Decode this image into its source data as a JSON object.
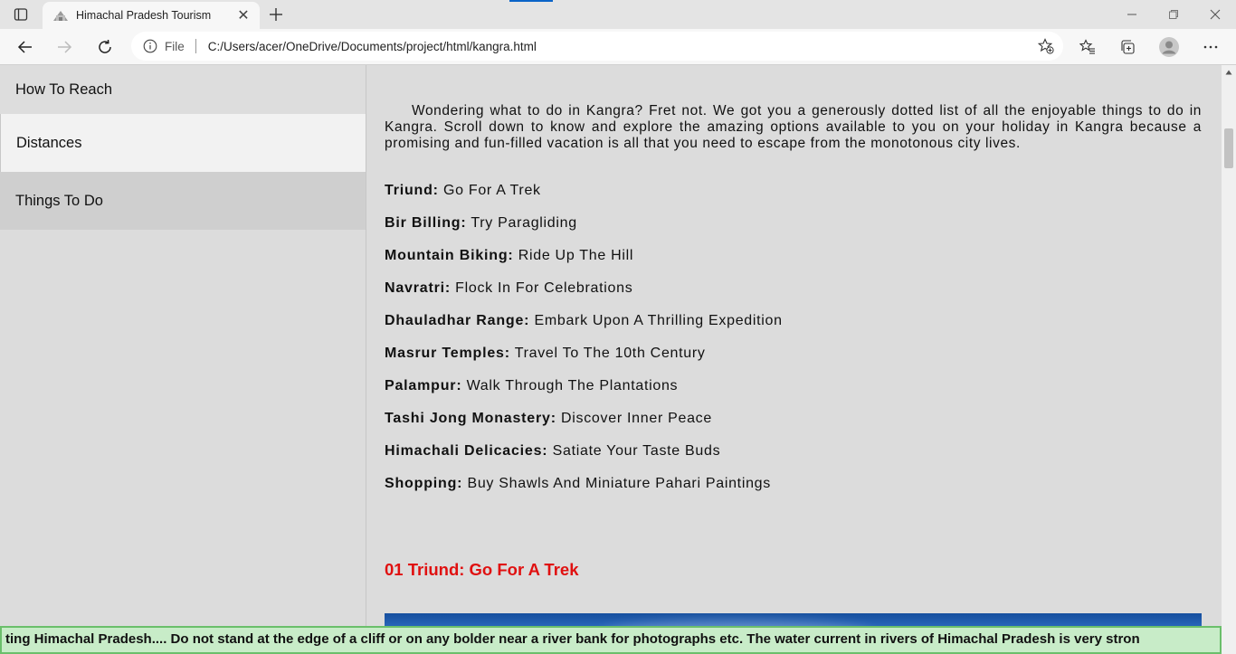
{
  "browser": {
    "tab_title": "Himachal Pradesh Tourism",
    "tab_close": "✕",
    "address": {
      "scheme": "File",
      "url": "C:/Users/acer/OneDrive/Documents/project/html/kangra.html"
    },
    "icons": {
      "tab_actions": "tab-actions-icon",
      "favicon": "site-favicon",
      "new_tab": "plus-icon",
      "back": "arrow-left-icon",
      "forward": "arrow-right-icon",
      "refresh": "refresh-icon",
      "info": "info-icon",
      "add_favorite": "star-plus-icon",
      "favorites": "favorites-icon",
      "collections": "collections-icon",
      "profile": "profile-icon",
      "more": "ellipsis-icon",
      "minimize": "minimize-icon",
      "restore": "restore-icon",
      "close": "close-icon"
    }
  },
  "sidebar": {
    "items": [
      {
        "label": "How To Reach"
      },
      {
        "label": "Distances"
      },
      {
        "label": "Things To Do"
      }
    ]
  },
  "main": {
    "intro": "Wondering what to do in Kangra? Fret not. We got you a generously dotted list of all the enjoyable things to do in Kangra. Scroll down to know and explore the amazing options available to you on your holiday in Kangra because a promising and fun-filled vacation is all that you need to escape from the monotonous city lives.",
    "activities": [
      {
        "place": "Triund:",
        "activity": " Go For A Trek"
      },
      {
        "place": "Bir Billing:",
        "activity": " Try Paragliding"
      },
      {
        "place": "Mountain Biking:",
        "activity": " Ride Up The Hill"
      },
      {
        "place": "Navratri:",
        "activity": " Flock In For Celebrations"
      },
      {
        "place": "Dhauladhar Range:",
        "activity": " Embark Upon A Thrilling Expedition"
      },
      {
        "place": "Masrur Temples:",
        "activity": " Travel To The 10th Century"
      },
      {
        "place": "Palampur:",
        "activity": " Walk Through The Plantations"
      },
      {
        "place": "Tashi Jong Monastery:",
        "activity": " Discover Inner Peace"
      },
      {
        "place": "Himachali Delicacies:",
        "activity": " Satiate Your Taste Buds"
      },
      {
        "place": "Shopping:",
        "activity": " Buy Shawls And Miniature Pahari Paintings"
      }
    ],
    "section_heading": "01 Triund: Go For A Trek"
  },
  "marquee": "ting Himachal Pradesh.... Do not stand at the edge of a cliff or on any bolder near a river bank for photographs etc. The water current in rivers of Himachal Pradesh is very stron",
  "colors": {
    "heading_red": "#e01010",
    "marquee_bg": "#c8ecc8",
    "marquee_border": "#6bbf6b",
    "page_bg": "#dcdcdc",
    "accent_blue": "#0a64c8"
  }
}
